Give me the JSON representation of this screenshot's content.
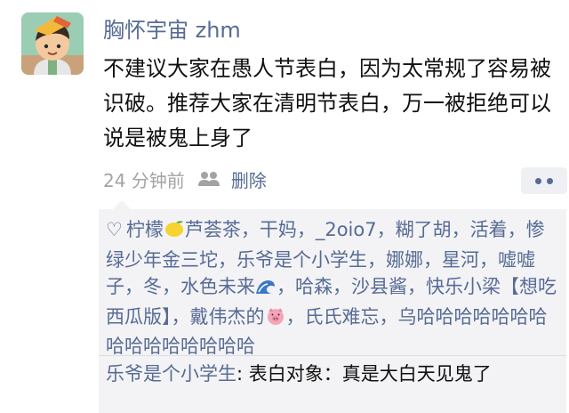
{
  "post": {
    "username": "胸怀宇宙 zhm",
    "text": "不建议大家在愚人节表白，因为太常规了容易被识破。推荐大家在清明节表白，万一被拒绝可以说是被鬼上身了",
    "time": "24 分钟前",
    "delete_label": "删除"
  },
  "icons": {
    "visibility": "people-icon",
    "more": "more-dots-icon",
    "like": "heart-icon",
    "lemon": "lemon-emoji",
    "wave": "wave-emoji",
    "pig": "pig-emoji"
  },
  "likes": {
    "names": [
      "柠檬",
      "芦荟茶",
      "干妈",
      "_2oio7",
      "糊了胡",
      "活着",
      "惨绿少年金三坨",
      "乐爷是个小学生",
      "娜娜",
      "星河",
      "嘘嘘子",
      "冬",
      "水色未来",
      "哈森",
      "沙县酱",
      "快乐小梁【想吃西瓜版】",
      "戴伟杰的",
      "氏氏难忘",
      "乌哈哈哈哈哈哈哈哈哈哈哈哈哈哈哈"
    ]
  },
  "comment": {
    "author": "乐爷是个小学生",
    "separator": ": ",
    "text": "表白对象：真是大白天见鬼了"
  },
  "colors": {
    "link": "#576b95",
    "meta_gray": "#a3a3a3",
    "panel_bg": "#f3f3f5"
  }
}
